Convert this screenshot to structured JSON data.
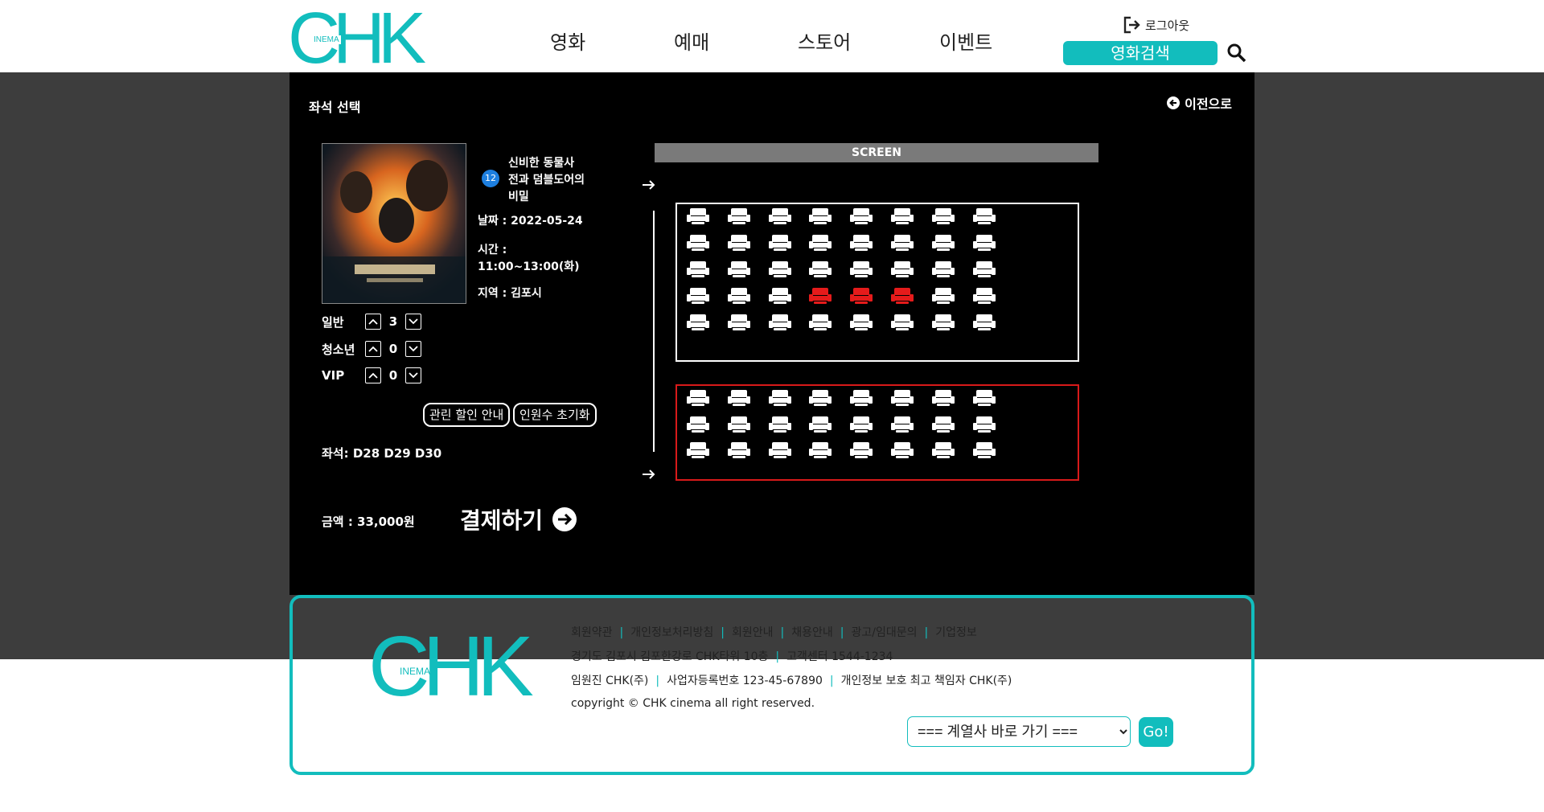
{
  "header": {
    "logo_main": "CHK",
    "logo_sub": "INEMA",
    "nav": [
      "영화",
      "예매",
      "스토어",
      "이벤트"
    ],
    "logout_label": "로그아웃",
    "search_button_label": "영화검색"
  },
  "modal": {
    "title": "좌석 선택",
    "back_label": "이전으로",
    "movie": {
      "age_rating": "12",
      "title_lines": [
        "신비한 동물사",
        "전과 덤블도어의",
        "비밀"
      ],
      "date": "날짜 : 2022-05-24",
      "time_label": "시간 :",
      "time_value": "11:00~13:00(화)",
      "region": "지역 : 김포시"
    },
    "counts": [
      {
        "label": "일반",
        "value": "3"
      },
      {
        "label": "청소년",
        "value": "0"
      },
      {
        "label": "VIP",
        "value": "0"
      }
    ],
    "discount_button": "관린 할인 안내",
    "reset_button": "인원수 초기화",
    "seats_text": "좌석: D28 D29 D30",
    "price_text": "금액 : 33,000원",
    "pay_button": "결제하기",
    "screen_label": "SCREEN",
    "seat_blocks": [
      {
        "rows": 5,
        "cols": 8,
        "selected": [
          [
            3,
            3
          ],
          [
            3,
            4
          ],
          [
            3,
            5
          ]
        ]
      },
      {
        "rows": 3,
        "cols": 8,
        "selected": []
      }
    ]
  },
  "footer": {
    "logo_main": "CHK",
    "logo_sub": "INEMA",
    "links": [
      "회원약관",
      "개인정보처리방침",
      "회원안내",
      "채용안내",
      "광고/임대문의",
      "기업정보"
    ],
    "address": [
      "경기도 김포시 김포한강로 CHK타워 10층",
      "고객센터 1544-1234"
    ],
    "company": [
      "임원진 CHK(주)",
      "사업자등록번호 123-45-67890",
      "개인정보 보호 최고 책임자 CHK(주)"
    ],
    "copyright": "copyright © CHK cinema all right reserved.",
    "family_select": "=== 계열사 바로 가기 ===",
    "go_button": "Go!"
  },
  "colors": {
    "accent": "#12bdbd",
    "selected_seat": "#e51b1b",
    "block_b_border": "#d81a1a"
  }
}
